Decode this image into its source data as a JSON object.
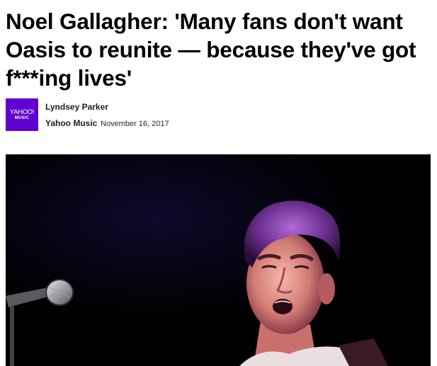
{
  "article": {
    "headline": "Noel Gallagher: 'Many fans don't want Oasis to reunite — because they've got f***ing lives'"
  },
  "byline": {
    "logo_text": "YAHOO!",
    "logo_subtext": "MUSIC",
    "author": "Lyndsey Parker",
    "provider": "Yahoo Music",
    "date": "November 16, 2017"
  },
  "colors": {
    "brand_purple": "#5f01d1",
    "photo_background": "#000000"
  }
}
